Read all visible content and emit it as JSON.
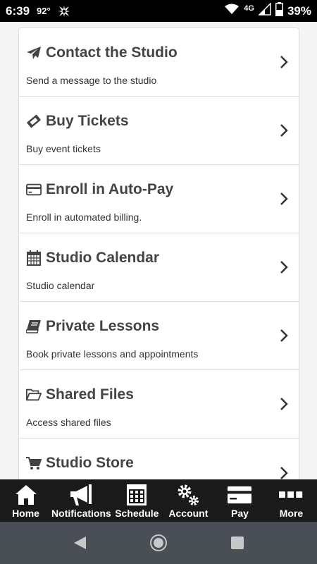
{
  "status": {
    "time": "6:39",
    "temperature": "92°",
    "network": "4G",
    "battery": "39%"
  },
  "menu": [
    {
      "title": "Contact the Studio",
      "desc": "Send a message to the studio",
      "icon": "paper-plane-icon"
    },
    {
      "title": "Buy Tickets",
      "desc": "Buy event tickets",
      "icon": "ticket-icon"
    },
    {
      "title": "Enroll in Auto-Pay",
      "desc": "Enroll in automated billing.",
      "icon": "credit-card-icon"
    },
    {
      "title": "Studio Calendar",
      "desc": "Studio calendar",
      "icon": "calendar-icon"
    },
    {
      "title": "Private Lessons",
      "desc": "Book private lessons and appointments",
      "icon": "book-icon"
    },
    {
      "title": "Shared Files",
      "desc": "Access shared files",
      "icon": "folder-open-icon"
    },
    {
      "title": "Studio Store",
      "desc": "",
      "icon": "shopping-cart-icon"
    }
  ],
  "tabs": [
    {
      "label": "Home",
      "icon": "home-icon"
    },
    {
      "label": "Notifications",
      "icon": "megaphone-icon"
    },
    {
      "label": "Schedule",
      "icon": "schedule-grid-icon"
    },
    {
      "label": "Account",
      "icon": "gears-icon"
    },
    {
      "label": "Pay",
      "icon": "card-icon"
    },
    {
      "label": "More",
      "icon": "more-dots-icon"
    }
  ],
  "colors": {
    "tab_bar": "#1a1a1a",
    "nav_bar": "#4a4e55",
    "title_text": "#444444"
  }
}
